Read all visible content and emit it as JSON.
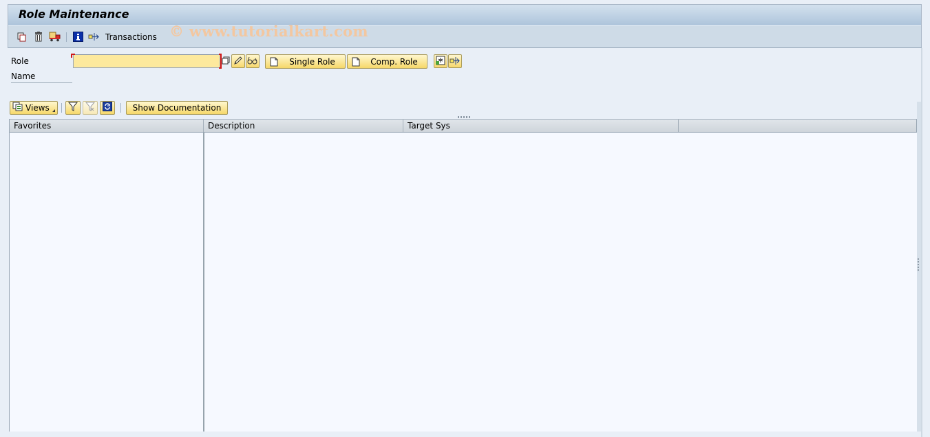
{
  "window": {
    "title": "Role Maintenance"
  },
  "toolbar": {
    "items": [
      {
        "icon": "copy-icon",
        "label": ""
      },
      {
        "icon": "delete-icon",
        "label": ""
      },
      {
        "icon": "transport-icon",
        "label": ""
      },
      {
        "icon": "info-icon",
        "label": ""
      },
      {
        "icon": "transactions-icon",
        "label": "Transactions"
      }
    ],
    "transactions_label": "Transactions"
  },
  "watermark": "© www.tutorialkart.com",
  "form": {
    "role_label": "Role",
    "role_value": "",
    "name_label": "Name",
    "buttons": {
      "single_role": "Single Role",
      "comp_role": "Comp. Role"
    }
  },
  "grid_toolbar": {
    "views_label": "Views",
    "show_documentation": "Show Documentation"
  },
  "grid": {
    "columns": [
      "Favorites",
      "Description",
      "Target Sys",
      ""
    ],
    "rows": []
  },
  "colors": {
    "title_bar": "#adc4db",
    "input_required_bg": "#fde99d",
    "button_bg": "#f6d869",
    "required_mark": "#d01818"
  }
}
